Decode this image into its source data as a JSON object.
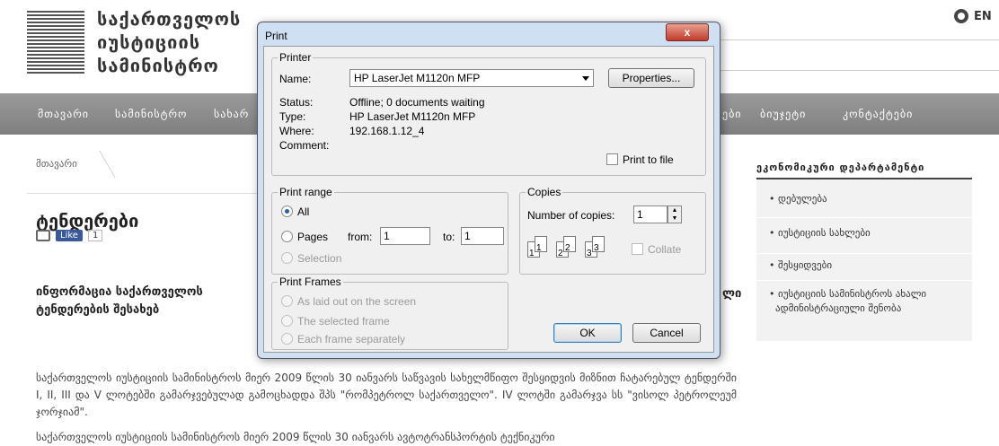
{
  "site": {
    "logo_lines": [
      "საქართველოს",
      "იუსტიციის",
      "სამინისტრო"
    ],
    "lang": "EN"
  },
  "nav": {
    "items": [
      "მთავარი",
      "სამინისტრო",
      "სახარ",
      "ები",
      "ბიუჯეტი",
      "კონტაქტები"
    ]
  },
  "content": {
    "breadcrumb": "მთავარი",
    "title": "ტენდერები",
    "fb_like": "Like",
    "fb_count": "1",
    "intro": "ინფორმაცია საქართველოს ტენდერების შესახებ",
    "intro_right": "ლი",
    "para1": "საქართველოს იუსტიციის სამინისტროს მიერ 2009 წლის 30 იანვარს საწვავის სახელმწიფო შესყიდვის მიზნით ჩატარებულ ტენდერში I, II, III და V ლოტებში გამარჯვებულად გამოცხადდა შპს \"რომპეტროლ საქართველო\". IV ლოტში გამარჯვა სს \"ვისოლ პეტროლეუმ ჯორჯიამ\".",
    "para2": "საქართველოს იუსტიციის სამინისტროს მიერ 2009 წლის 30 იანვარს ავტოტრანსპორტის ტექნიკური"
  },
  "sidebar": {
    "title": "ეკონომიკური დეპარტამენტი",
    "items": [
      "დებულება",
      "იუსტიციის სახლები",
      "შესყიდვები",
      "იუსტიციის სამინისტროს ახალი",
      "ადმინისტრაციული შენობა"
    ]
  },
  "dialog": {
    "title": "Print",
    "close": "x",
    "printer_group": "Printer",
    "name_label": "Name:",
    "printer_name": "HP LaserJet M1120n MFP",
    "properties": "Properties...",
    "status_label": "Status:",
    "status_value": "Offline; 0 documents waiting",
    "type_label": "Type:",
    "type_value": "HP LaserJet M1120n MFP",
    "where_label": "Where:",
    "where_value": "192.168.1.12_4",
    "comment_label": "Comment:",
    "print_to_file": "Print to file",
    "range_group": "Print range",
    "all": "All",
    "pages": "Pages",
    "from_label": "from:",
    "from_value": "1",
    "to_label": "to:",
    "to_value": "1",
    "selection": "Selection",
    "copies_group": "Copies",
    "copies_label": "Number of copies:",
    "copies_value": "1",
    "collate": "Collate",
    "frames_group": "Print Frames",
    "frame_1": "As laid out on the screen",
    "frame_2": "The selected frame",
    "frame_3": "Each frame separately",
    "ok": "OK",
    "cancel": "Cancel",
    "stack_labels": [
      "1",
      "1",
      "2",
      "2",
      "3",
      "3"
    ]
  }
}
